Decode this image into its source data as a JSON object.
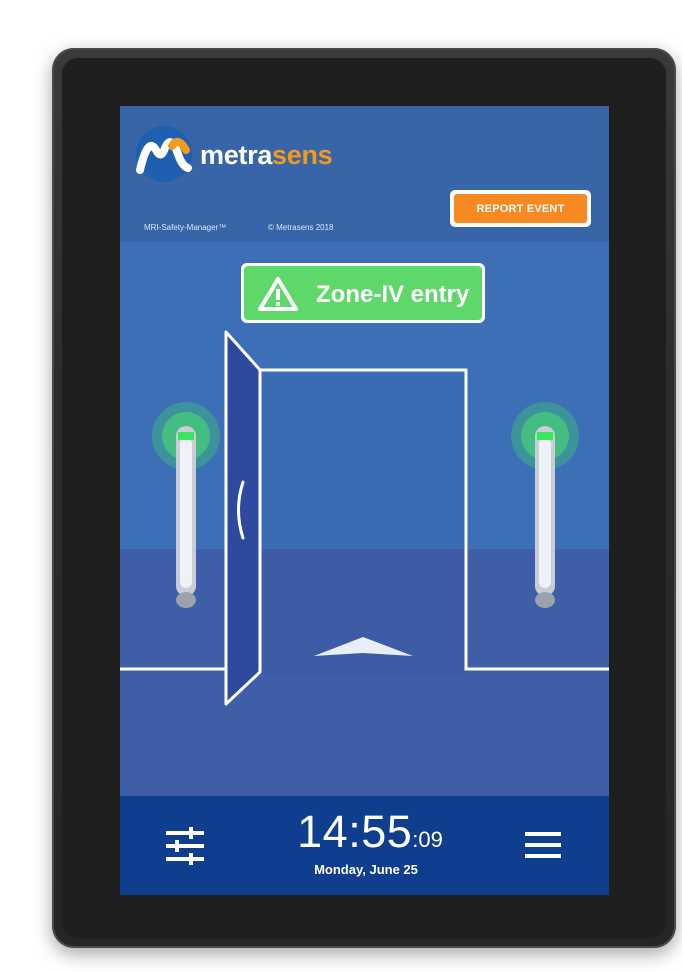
{
  "brand": {
    "name_part1": "metra",
    "name_part2": "sens",
    "product": "MRI-Safety-Manager™",
    "copyright": "© Metrasens 2018"
  },
  "header": {
    "report_button_label": "REPORT EVENT"
  },
  "alert": {
    "text": "Zone-IV entry",
    "icon": "warning-triangle-icon"
  },
  "detectors": {
    "left_status": "green",
    "right_status": "green"
  },
  "footer": {
    "time_hm": "14:55",
    "time_sec": ":09",
    "date": "Monday, June 25",
    "settings_icon": "sliders-icon",
    "menu_icon": "hamburger-menu-icon"
  },
  "colors": {
    "screen_bg": "#3c6fb6",
    "header_bg": "#3864a8",
    "footer_bg": "#0e3e8d",
    "accent_orange": "#f6891f",
    "alert_green": "#5fd86b"
  }
}
